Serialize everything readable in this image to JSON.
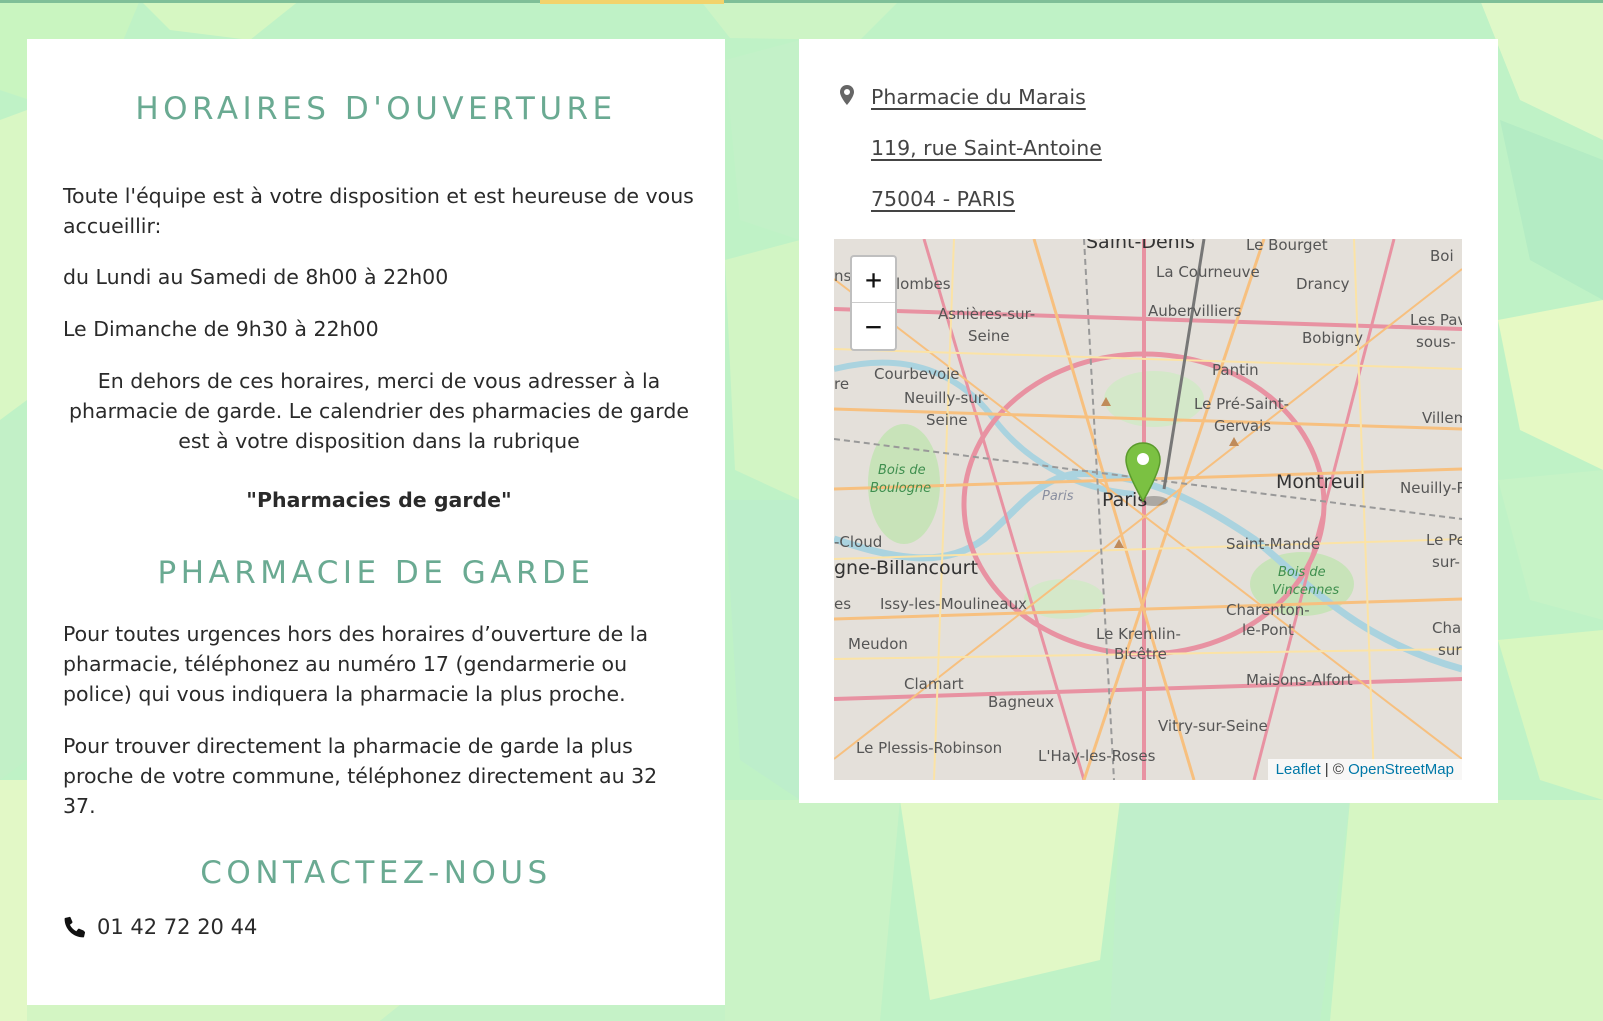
{
  "hours": {
    "title": "HORAIRES D'OUVERTURE",
    "intro": "Toute l'équipe est à votre disposition et est heureuse de vous accueillir:",
    "weekdays": "du Lundi au Samedi de 8h00 à 22h00",
    "sunday": "Le Dimanche de 9h30 à 22h00",
    "outside": "En dehors de ces horaires, merci de vous adresser à la pharmacie de garde. Le calendrier des pharmacies de garde est à votre disposition dans la rubrique",
    "rubrique": "\"Pharmacies de garde\""
  },
  "garde": {
    "title": "PHARMACIE DE GARDE",
    "para1": "Pour toutes urgences hors des horaires d’ouverture de la pharmacie, téléphonez au numéro 17 (gendarmerie ou police) qui vous indiquera la pharmacie la plus proche.",
    "para2": "Pour trouver directement la pharmacie de garde la plus proche de votre commune, téléphonez directement au 32 37."
  },
  "contact": {
    "title": "CONTACTEZ-NOUS",
    "phone": "01 42 72 20 44",
    "phone_icon": "phone-icon"
  },
  "address": {
    "pin_icon": "map-pin-icon",
    "name": "Pharmacie du Marais",
    "street": "119, rue Saint-Antoine",
    "city": "75004 - PARIS"
  },
  "map": {
    "zoom_in": "+",
    "zoom_out": "−",
    "attribution_leaflet": "Leaflet",
    "attribution_sep": " | © ",
    "attribution_osm": "OpenStreetMap",
    "labels": {
      "saint_denis": "Saint-Denis",
      "le_bourget": "Le Bourget",
      "bo": "Boi",
      "colombes": "lombes",
      "la_courneuve": "La Courneuve",
      "drancy": "Drancy",
      "asnieres": "Asnières-sur-",
      "seine1": "Seine",
      "aubervilliers": "Aubervilliers",
      "bobigny": "Bobigny",
      "les_pav": "Les Pav",
      "sous": "sous-",
      "courbevoie": "Courbevoie",
      "pantin": "Pantin",
      "neuilly": "Neuilly-sur-",
      "seine2": "Seine",
      "pre_saint": "Le Pré-Saint-",
      "gervais": "Gervais",
      "villem": "Villem",
      "bois_boulogne1": "Bois de",
      "bois_boulogne2": "Boulogne",
      "paris_small": "Paris",
      "paris": "Paris",
      "montreuil": "Montreuil",
      "neuilly_pl": "Neuilly-P",
      "st_cloud": "-Cloud",
      "saint_mande": "Saint-Mandé",
      "le_pe": "Le Pe",
      "sur": "sur-",
      "billancourt": "gne-Billancourt",
      "bois_vincennes1": "Bois de",
      "bois_vincennes2": "Vincennes",
      "issy": "Issy-les-Moulineaux",
      "charenton": "Charenton-",
      "le_pont": "le-Pont",
      "cha": "Cha",
      "sur2": "sur",
      "meudon": "Meudon",
      "kremlin": "Le Kremlin-",
      "bicetre": "Bicêtre",
      "clamart": "Clamart",
      "maisons_alfort": "Maisons-Alfort",
      "bagneux": "Bagneux",
      "vitry": "Vitry-sur-Seine",
      "plessis": "Le Plessis-Robinson",
      "hay": "L'Hay-les-Roses",
      "es": "es",
      "re": "re",
      "ns": "ns"
    }
  }
}
